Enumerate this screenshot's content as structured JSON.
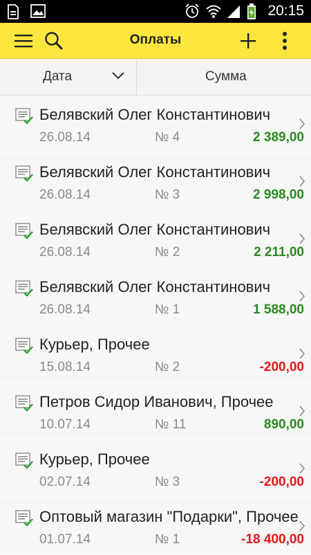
{
  "status_bar": {
    "time": "20:15",
    "icons": [
      "file-icon",
      "image-icon",
      "alarm-icon",
      "wifi-icon",
      "signal-icon",
      "battery-charging-icon"
    ]
  },
  "toolbar": {
    "title": "Оплаты",
    "menu_icon": "hamburger-icon",
    "search_icon": "search-icon",
    "add_icon": "plus-icon",
    "more_icon": "more-vertical-icon",
    "accent_color": "#fbe63f"
  },
  "sort": {
    "date_label": "Дата",
    "sum_label": "Сумма"
  },
  "colors": {
    "positive": "#2a8a1e",
    "negative": "#e01818"
  },
  "payments": [
    {
      "name": "Белявский Олег Константинович",
      "date": "26.08.14",
      "number": "№ 4",
      "amount": "2 389,00",
      "sign": "positive"
    },
    {
      "name": "Белявский Олег Константинович",
      "date": "26.08.14",
      "number": "№ 3",
      "amount": "2 998,00",
      "sign": "positive"
    },
    {
      "name": "Белявский Олег Константинович",
      "date": "26.08.14",
      "number": "№ 2",
      "amount": "2 211,00",
      "sign": "positive"
    },
    {
      "name": "Белявский Олег Константинович",
      "date": "26.08.14",
      "number": "№ 1",
      "amount": "1 588,00",
      "sign": "positive"
    },
    {
      "name": "Курьер, Прочее",
      "date": "15.08.14",
      "number": "№ 2",
      "amount": "-200,00",
      "sign": "negative"
    },
    {
      "name": "Петров Сидор Иванович, Прочее",
      "date": "10.07.14",
      "number": "№ 11",
      "amount": "890,00",
      "sign": "positive"
    },
    {
      "name": "Курьер, Прочее",
      "date": "02.07.14",
      "number": "№ 3",
      "amount": "-200,00",
      "sign": "negative"
    },
    {
      "name": "Оптовый магазин \"Подарки\", Прочее",
      "date": "01.07.14",
      "number": "№ 1",
      "amount": "-18 400,00",
      "sign": "negative"
    }
  ]
}
